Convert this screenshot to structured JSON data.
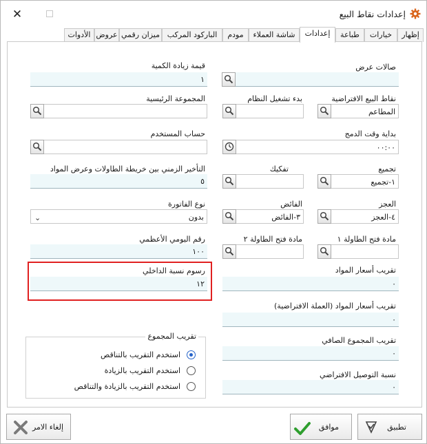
{
  "window": {
    "title": "إعدادات نقاط البيع",
    "close_glyph": "✕"
  },
  "tabs": [
    {
      "label": "إظهار",
      "active": false
    },
    {
      "label": "خيارات",
      "active": false
    },
    {
      "label": "طباعة",
      "active": false
    },
    {
      "label": "إعدادات",
      "active": true
    },
    {
      "label": "شاشة العملاء",
      "active": false
    },
    {
      "label": "مودم",
      "active": false
    },
    {
      "label": "الباركود المركب",
      "active": false
    },
    {
      "label": "ميزان رقمي",
      "active": false
    },
    {
      "label": "عروض",
      "active": false
    },
    {
      "label": "الأدوات",
      "active": false
    }
  ],
  "form": {
    "halat_ard": {
      "label": "صالات عرض",
      "value": ""
    },
    "qty_increase": {
      "label": "قيمة زيادة الكمية",
      "value": "١"
    },
    "default_pos": {
      "label": "نقاط البيع الافتراضية",
      "value": "المطاعم"
    },
    "startup": {
      "label": "بدء تشغيل النظام",
      "value": ""
    },
    "main_group": {
      "label": "المجموعة الرئيسية",
      "value": ""
    },
    "merge_start": {
      "label": "بداية وقت الدمج",
      "value": "٠٠:٠٠"
    },
    "user_account": {
      "label": "حساب المستخدم",
      "value": ""
    },
    "grouping": {
      "label": "تجميع",
      "value": "١-تجميع"
    },
    "disassemble": {
      "label": "تفكيك",
      "value": ""
    },
    "delay": {
      "label": "التأخير الزمني بين خريطة الطاولات وعرض المواد",
      "value": "٥"
    },
    "deficit": {
      "label": "العجز",
      "value": "٤-العجز"
    },
    "surplus": {
      "label": "الفائض",
      "value": "٣-الفائض"
    },
    "invoice_type": {
      "label": "نوع الفاتورة",
      "value": "بدون"
    },
    "open_table_1": {
      "label": "مادة فتح الطاولة ١",
      "value": ""
    },
    "open_table_2": {
      "label": "مادة فتح الطاولة ٢",
      "value": ""
    },
    "max_daily": {
      "label": "رقم اليومي الأعظمي",
      "value": "١٠٠"
    },
    "price_rounding": {
      "label": "تقريب أسعار المواد",
      "value": "٠"
    },
    "internal_fee": {
      "label": "رسوم نسبة الداخلي",
      "value": "١٢"
    },
    "price_rounding_default": {
      "label": "تقريب أسعار المواد (العملة الافتراضية)",
      "value": "٠"
    },
    "net_total_rounding": {
      "label": "تقريب المجموع الصافي",
      "value": "٠"
    },
    "delivery_ratio": {
      "label": "نسبة التوصيل الافتراضي",
      "value": "٠"
    }
  },
  "rounding_group": {
    "title": "تقريب المجموع",
    "options": [
      {
        "label": "استخدم التقريب بالتناقص",
        "selected": true
      },
      {
        "label": "استخدم التقريب بالزيادة",
        "selected": false
      },
      {
        "label": "استخدم التقريب بالزيادة والتناقص",
        "selected": false
      }
    ]
  },
  "buttons": {
    "apply": "تطبيق",
    "ok": "موافق",
    "cancel": "إلغاء الامر"
  },
  "colors": {
    "accent": "#2563c9",
    "highlight": "#e02020",
    "field_bg": "#eef8fa",
    "ok_green": "#2e9e2e",
    "cancel_gray": "#7a7a7a"
  },
  "icons": {
    "title": "gear-icon",
    "lookup": "magnifier-icon",
    "time": "clock-icon",
    "apply": "apply-icon",
    "ok": "checkmark-icon",
    "cancel": "x-mark-icon"
  }
}
